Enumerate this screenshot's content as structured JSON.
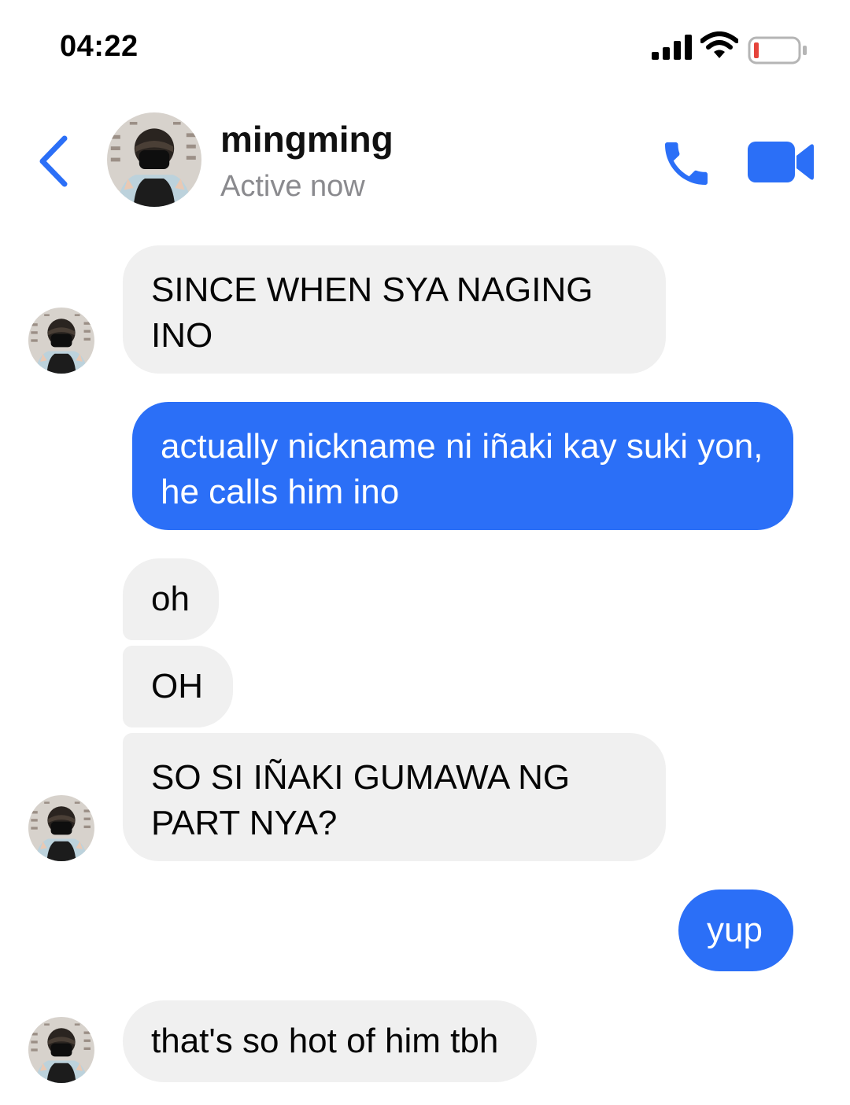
{
  "status_bar": {
    "time": "04:22"
  },
  "header": {
    "contact_name": "mingming",
    "contact_status": "Active now"
  },
  "messages": [
    {
      "direction": "in",
      "lines": [
        "SINCE WHEN SYA NAGING",
        "INO"
      ]
    },
    {
      "direction": "out",
      "lines": [
        "actually nickname ni iñaki kay suki yon,",
        "he calls him ino"
      ]
    },
    {
      "direction": "in",
      "lines": [
        "oh"
      ]
    },
    {
      "direction": "in",
      "lines": [
        "OH"
      ]
    },
    {
      "direction": "in",
      "lines": [
        "SO SI IÑAKI GUMAWA NG",
        "PART NYA?"
      ]
    },
    {
      "direction": "out",
      "lines": [
        "yup"
      ]
    },
    {
      "direction": "in",
      "lines": [
        "that's so hot of him tbh"
      ]
    }
  ],
  "colors": {
    "accent": "#2b6ff7",
    "incoming_bubble": "#f0f0f0",
    "battery_low": "#e5443b"
  },
  "icons": [
    "back-chevron-icon",
    "phone-icon",
    "video-camera-icon",
    "signal-icon",
    "wifi-icon",
    "battery-icon"
  ]
}
